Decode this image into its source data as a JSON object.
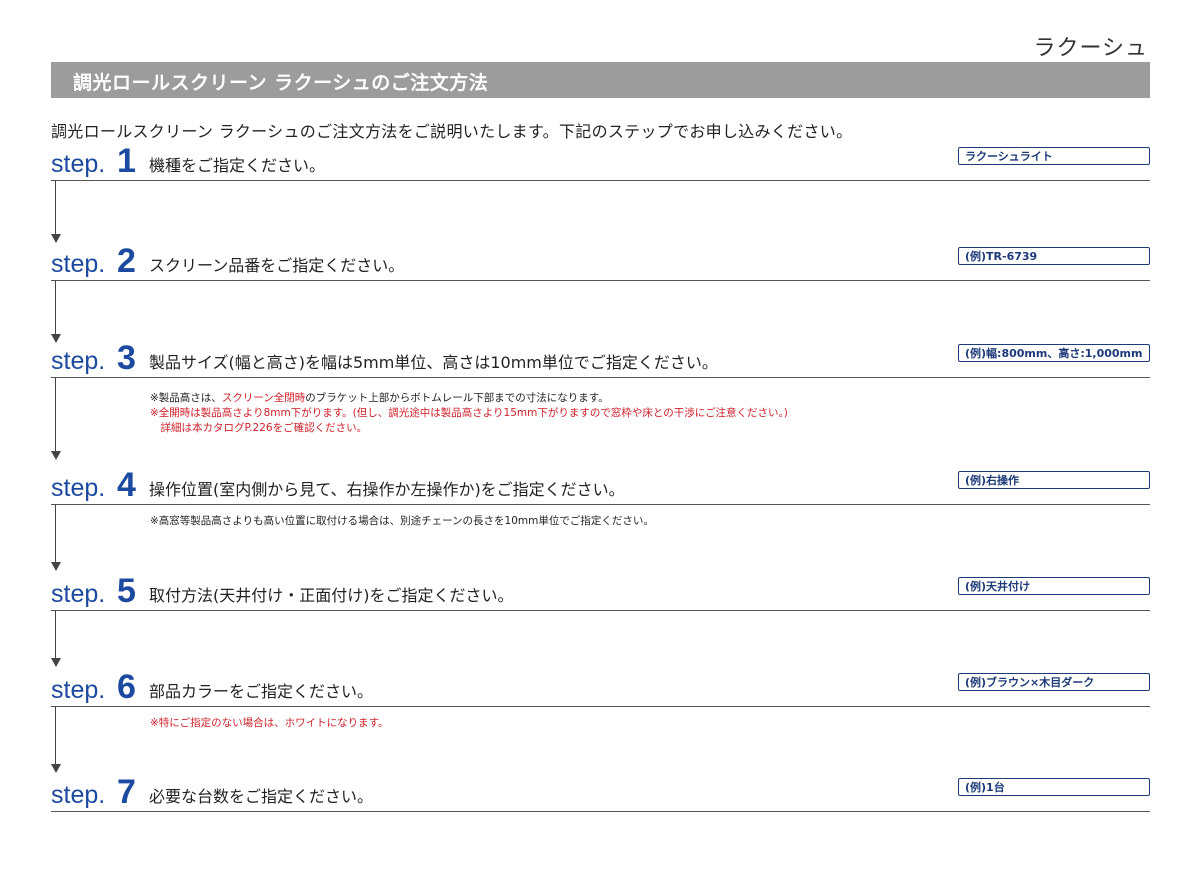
{
  "brand": "ラクーシュ",
  "title": "調光ロールスクリーン ラクーシュのご注文方法",
  "intro": "調光ロールスクリーン ラクーシュのご注文方法をご説明いたします。下記のステップでお申し込みください。",
  "step_word": "step.",
  "steps": [
    {
      "num": "1",
      "text": "機種をご指定ください。",
      "example": "ラクーシュライト",
      "notes": []
    },
    {
      "num": "2",
      "text": "スクリーン品番をご指定ください。",
      "example": "(例)TR-6739",
      "notes": []
    },
    {
      "num": "3",
      "text": "製品サイズ(幅と高さ)を幅は5mm単位、高さは10mm単位でご指定ください。",
      "example": "(例)幅:800mm、高さ:1,000mm",
      "notes": [
        {
          "black_a": "※製品高さは、",
          "red": "スクリーン全閉時",
          "black_b": "のブラケット上部からボトムレール下部までの寸法になります。"
        },
        {
          "red": "※全開時は製品高さより8mm下がります。(但し、調光途中は製品高さより15mm下がりますので窓枠や床との干渉にご注意ください。)"
        },
        {
          "red": "　詳細は本カタログP.226をご確認ください。"
        }
      ]
    },
    {
      "num": "4",
      "text": "操作位置(室内側から見て、右操作か左操作か)をご指定ください。",
      "example": "(例)右操作",
      "notes": [
        {
          "black_a": "※高窓等製品高さよりも高い位置に取付ける場合は、別途チェーンの長さを10mm単位でご指定ください。"
        }
      ]
    },
    {
      "num": "5",
      "text": "取付方法(天井付け・正面付け)をご指定ください。",
      "example": "(例)天井付け",
      "notes": []
    },
    {
      "num": "6",
      "text": "部品カラーをご指定ください。",
      "example": "(例)ブラウン×木目ダーク",
      "notes": [
        {
          "red": "※特にご指定のない場合は、ホワイトになります。"
        }
      ]
    },
    {
      "num": "7",
      "text": "必要な台数をご指定ください。",
      "example": "(例)1台",
      "notes": []
    }
  ],
  "colors": {
    "step_blue": "#1c4aa0",
    "title_bar_gray": "#9c9c9c",
    "note_red": "#d0202a",
    "example_border": "#1c3a78"
  }
}
